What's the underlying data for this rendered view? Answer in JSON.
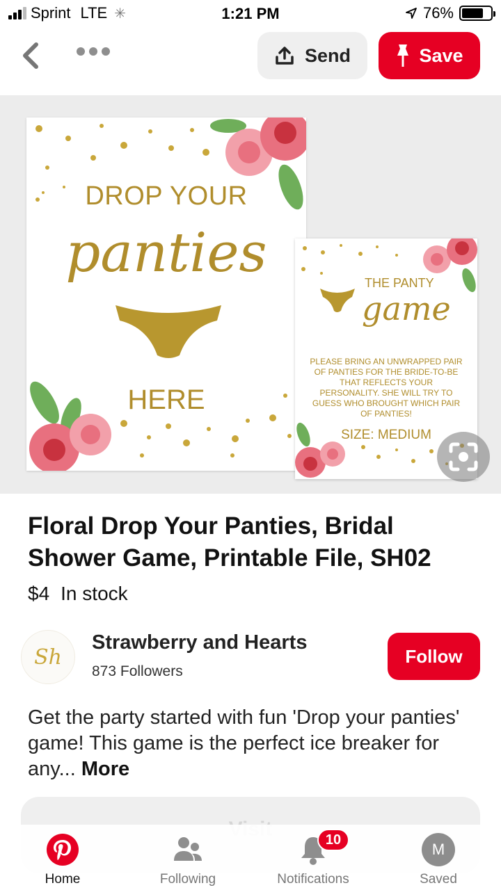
{
  "status_bar": {
    "carrier": "Sprint",
    "network": "LTE",
    "time": "1:21 PM",
    "battery": "76%",
    "battery_level": 0.76
  },
  "toolbar": {
    "back_icon": "chevron-left-icon",
    "more_icon": "ellipsis-icon",
    "send_label": "Send",
    "save_label": "Save",
    "accent_color": "#e60023"
  },
  "image": {
    "large_card": {
      "title": "DROP YOUR",
      "script": "panties",
      "bottom": "HERE"
    },
    "small_card": {
      "title": "THE PANTY",
      "script": "game",
      "body": "PLEASE BRING AN UNWRAPPED PAIR OF PANTIES FOR THE BRIDE-TO-BE THAT REFLECTS YOUR PERSONALITY. SHE WILL TRY TO GUESS WHO BROUGHT WHICH PAIR OF PANTIES!",
      "size": "SIZE: MEDIUM"
    },
    "lens_icon": "visual-search-icon"
  },
  "pin": {
    "title": "Floral Drop Your Panties, Bridal Shower Game, Printable File, SH02",
    "price": "$4",
    "availability": "In stock"
  },
  "creator": {
    "avatar_text": "Sh",
    "name": "Strawberry and Hearts",
    "followers": "873 Followers",
    "follow_label": "Follow"
  },
  "description": {
    "text": "Get the party started with fun 'Drop your panties' game! This game is the perfect ice breaker for any...",
    "more_label": "More"
  },
  "visit": {
    "label": "Visit"
  },
  "bottom_nav": {
    "home": "Home",
    "following": "Following",
    "notifications": "Notifications",
    "notifications_badge": "10",
    "saved": "Saved",
    "saved_avatar": "M"
  }
}
